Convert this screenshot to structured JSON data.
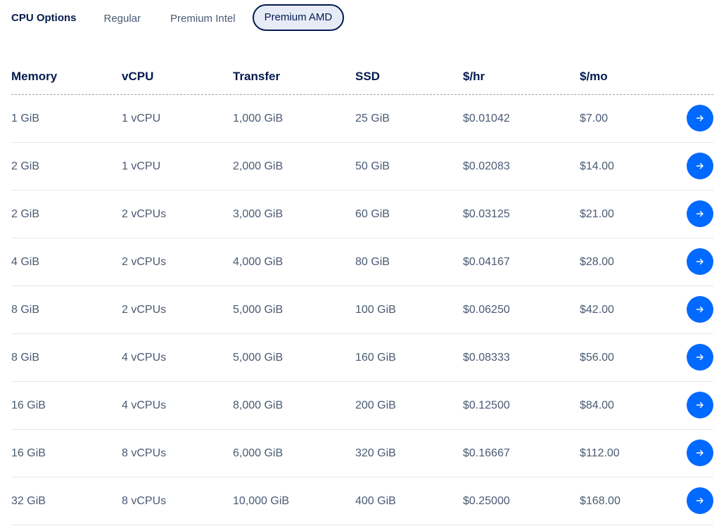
{
  "cpu_options": {
    "title": "CPU Options",
    "tabs": [
      {
        "label": "Regular",
        "active": false
      },
      {
        "label": "Premium Intel",
        "active": false
      },
      {
        "label": "Premium AMD",
        "active": true
      }
    ]
  },
  "table": {
    "headers": [
      "Memory",
      "vCPU",
      "Transfer",
      "SSD",
      "$/hr",
      "$/mo"
    ],
    "rows": [
      [
        "1 GiB",
        "1 vCPU",
        "1,000 GiB",
        "25 GiB",
        "$0.01042",
        "$7.00"
      ],
      [
        "2 GiB",
        "1 vCPU",
        "2,000 GiB",
        "50 GiB",
        "$0.02083",
        "$14.00"
      ],
      [
        "2 GiB",
        "2 vCPUs",
        "3,000 GiB",
        "60 GiB",
        "$0.03125",
        "$21.00"
      ],
      [
        "4 GiB",
        "2 vCPUs",
        "4,000 GiB",
        "80 GiB",
        "$0.04167",
        "$28.00"
      ],
      [
        "8 GiB",
        "2 vCPUs",
        "5,000 GiB",
        "100 GiB",
        "$0.06250",
        "$42.00"
      ],
      [
        "8 GiB",
        "4 vCPUs",
        "5,000 GiB",
        "160 GiB",
        "$0.08333",
        "$56.00"
      ],
      [
        "16 GiB",
        "4 vCPUs",
        "8,000 GiB",
        "200 GiB",
        "$0.12500",
        "$84.00"
      ],
      [
        "16 GiB",
        "8 vCPUs",
        "6,000 GiB",
        "320 GiB",
        "$0.16667",
        "$112.00"
      ],
      [
        "32 GiB",
        "8 vCPUs",
        "10,000 GiB",
        "400 GiB",
        "$0.25000",
        "$168.00"
      ]
    ],
    "row_action_icon": "arrow-right-icon"
  },
  "colors": {
    "accent": "#0069ff",
    "heading": "#031b4e",
    "body_text": "#4a5a73",
    "active_tab_bg": "#e6ebf7"
  }
}
